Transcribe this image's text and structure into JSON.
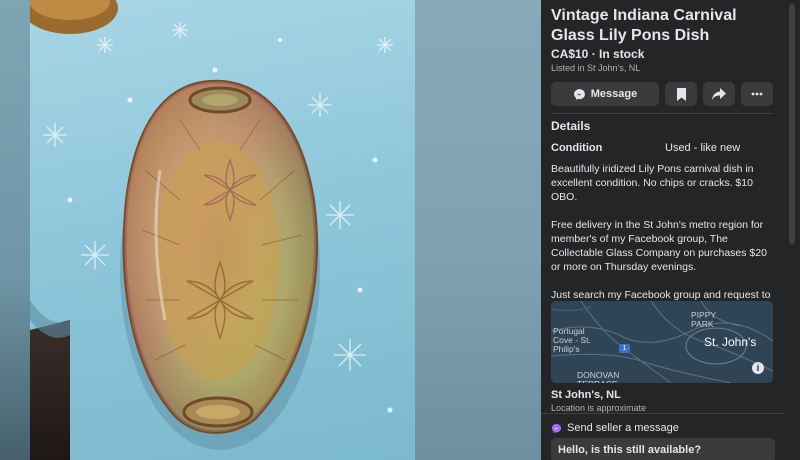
{
  "listing": {
    "title": "Vintage Indiana Carnival Glass Lily Pons Dish",
    "price_status": "CA$10 · In stock",
    "listed_in": "Listed in St John's, NL"
  },
  "actions": {
    "message_label": "Message",
    "save_icon": "bookmark-icon",
    "share_icon": "share-arrow-icon",
    "more_icon": "more-dots-icon"
  },
  "details": {
    "heading": "Details",
    "condition_label": "Condition",
    "condition_value": "Used - like new",
    "description": [
      "Beautifully iridized Lily Pons carnival dish in excellent condition. No chips or cracks. $10 OBO.",
      "Free delivery in the St John's metro region for member's of my Facebook group, The Collectable Glass Company on purchases $20 or more on Thursday evenings.",
      "Just search my Facebook group and request to join."
    ]
  },
  "map": {
    "labels": {
      "portugal_cove": "Portugal\nCove - St.\nPhilip's",
      "pippy_park": "PIPPY\nPARK",
      "donovan": "DONOVAN\nTERRACE",
      "city": "St. John's",
      "route_badge": "1"
    },
    "city": "St John's, NL",
    "approx_note": "Location is approximate"
  },
  "seller": {
    "send_label": "Send seller a message",
    "message_value": "Hello, is this still available?"
  },
  "colors": {
    "panel_bg": "#242526",
    "button_bg": "#3a3b3c",
    "text": "#e4e6eb",
    "secondary_text": "#b0b3b8"
  }
}
